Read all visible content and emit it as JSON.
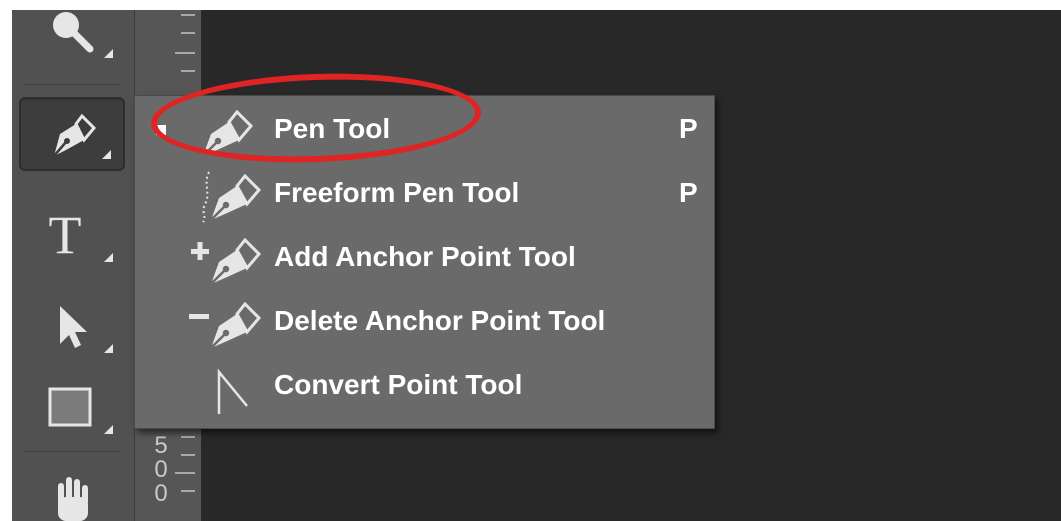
{
  "toolbar": {
    "tools": [
      {
        "name": "Zoom Tool",
        "icon": "magnifier-icon"
      },
      {
        "name": "Pen Tool",
        "icon": "pen-icon",
        "selected": true
      },
      {
        "name": "Type Tool",
        "icon": "type-icon",
        "glyph": "T"
      },
      {
        "name": "Path Selection Tool",
        "icon": "arrow-cursor-icon"
      },
      {
        "name": "Rectangle Tool",
        "icon": "rectangle-icon"
      },
      {
        "name": "Hand Tool",
        "icon": "hand-icon"
      }
    ]
  },
  "ruler": {
    "digits": [
      "5",
      "0",
      "0"
    ]
  },
  "flyout": {
    "items": [
      {
        "label": "Pen Tool",
        "shortcut": "P",
        "checked": true,
        "icon": "pen-icon"
      },
      {
        "label": "Freeform Pen Tool",
        "shortcut": "P",
        "checked": false,
        "icon": "freeform-pen-icon"
      },
      {
        "label": "Add Anchor Point Tool",
        "shortcut": "",
        "checked": false,
        "icon": "add-anchor-point-icon"
      },
      {
        "label": "Delete Anchor Point Tool",
        "shortcut": "",
        "checked": false,
        "icon": "delete-anchor-point-icon"
      },
      {
        "label": "Convert Point Tool",
        "shortcut": "",
        "checked": false,
        "icon": "convert-point-icon"
      }
    ]
  },
  "annotation": {
    "color": "#e02323",
    "target": "Pen Tool"
  },
  "colors": {
    "toolbar_bg": "#515151",
    "canvas_bg": "#282828",
    "menu_bg": "#6a6a6a",
    "menu_text": "#ffffff"
  }
}
